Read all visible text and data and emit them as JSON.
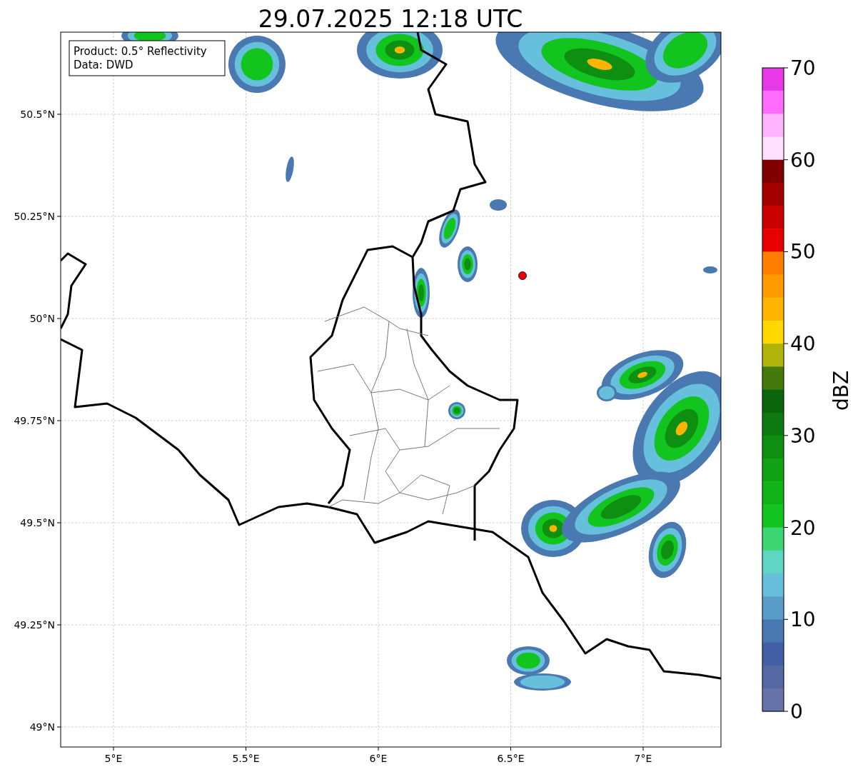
{
  "title": "29.07.2025 12:18 UTC",
  "info_box": {
    "lines": [
      "Product: 0.5° Reflectivity",
      "Data: DWD"
    ]
  },
  "map": {
    "lat_ticks": [
      "50.5°N",
      "50.25°N",
      "50°N",
      "49.75°N",
      "49.5°N",
      "49.25°N",
      "49°N"
    ],
    "lon_ticks": [
      "5°E",
      "5.5°E",
      "6°E",
      "6.5°E",
      "7°E"
    ]
  },
  "colorbar": {
    "label": "dBZ",
    "ticks": [
      "70",
      "60",
      "50",
      "40",
      "30",
      "20",
      "10",
      "0"
    ],
    "bands": [
      {
        "color": "#e838e8"
      },
      {
        "color": "#ff6cff"
      },
      {
        "color": "#ffb4ff"
      },
      {
        "color": "#ffe0ff"
      },
      {
        "color": "#800000"
      },
      {
        "color": "#a50000"
      },
      {
        "color": "#c80000"
      },
      {
        "color": "#e60000"
      },
      {
        "color": "#ff7e00"
      },
      {
        "color": "#ff9a00"
      },
      {
        "color": "#ffb400"
      },
      {
        "color": "#ffd800"
      },
      {
        "color": "#b0b40a"
      },
      {
        "color": "#447a0c"
      },
      {
        "color": "#0a650d"
      },
      {
        "color": "#0c7a10"
      },
      {
        "color": "#0e8f12"
      },
      {
        "color": "#0fa314"
      },
      {
        "color": "#10b418"
      },
      {
        "color": "#12c41e"
      },
      {
        "color": "#3ed672"
      },
      {
        "color": "#5fd6c4"
      },
      {
        "color": "#66c0dc"
      },
      {
        "color": "#5a9cc8"
      },
      {
        "color": "#4a78b0"
      },
      {
        "color": "#425ea5"
      },
      {
        "color": "#5468a3"
      },
      {
        "color": "#6573a8"
      }
    ]
  }
}
